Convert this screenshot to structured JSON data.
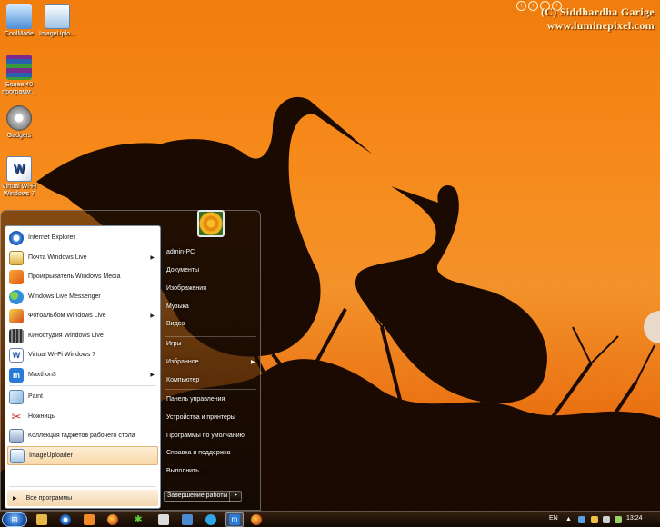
{
  "wallpaper": {
    "watermark_line1": "(C) Siddhardha Garige",
    "watermark_line2": "www.luminepixel.com",
    "controls": [
      "+",
      "+",
      "+",
      "+"
    ]
  },
  "desktop_icons": [
    {
      "label": "CoolMode",
      "icon": "app-icon"
    },
    {
      "label": "ImageUplo...",
      "icon": "image-uploader-icon"
    },
    {
      "label": "Более 40 программ...",
      "icon": "winrar-icon"
    },
    {
      "label": "Gadgets",
      "icon": "gadgets-icon"
    },
    {
      "label": "Virtual Wi-Fi Windows 7",
      "icon": "word-document-icon"
    }
  ],
  "start_menu": {
    "programs": [
      {
        "label": "Internet Explorer",
        "icon": "internet-explorer-icon",
        "submenu": false
      },
      {
        "label": "Почта Windows Live",
        "icon": "mail-icon",
        "submenu": true
      },
      {
        "label": "Проигрыватель Windows Media",
        "icon": "media-player-icon",
        "submenu": false
      },
      {
        "label": "Windows Live Messenger",
        "icon": "messenger-icon",
        "submenu": false
      },
      {
        "label": "Фотоальбом Windows Live",
        "icon": "photo-gallery-icon",
        "submenu": true
      },
      {
        "label": "Киностудия Windows Live",
        "icon": "movie-maker-icon",
        "submenu": false
      },
      {
        "label": "Virtual Wi-Fi Windows 7",
        "icon": "word-document-icon",
        "submenu": false
      },
      {
        "label": "Maxthon3",
        "icon": "maxthon-icon",
        "submenu": true
      },
      {
        "label": "Paint",
        "icon": "paint-icon",
        "submenu": false
      },
      {
        "label": "Ножницы",
        "icon": "scissors-icon",
        "submenu": false
      },
      {
        "label": "Коллекция гаджетов рабочего стола",
        "icon": "gadgets-icon",
        "submenu": false
      },
      {
        "label": "ImageUploader",
        "icon": "image-uploader-icon",
        "submenu": false,
        "selected": true
      }
    ],
    "all_programs": "Все программы",
    "right_links": [
      {
        "label": "admin-PC",
        "submenu": false
      },
      {
        "label": "Документы",
        "submenu": false
      },
      {
        "label": "Изображения",
        "submenu": false
      },
      {
        "label": "Музыка",
        "submenu": false
      },
      {
        "label": "Видео",
        "submenu": false
      },
      {
        "label": "Игры",
        "submenu": false
      },
      {
        "label": "Избранное",
        "submenu": true
      },
      {
        "label": "Компьютер",
        "submenu": false
      },
      {
        "label": "Панель управления",
        "submenu": false
      },
      {
        "label": "Устройства и принтеры",
        "submenu": false
      },
      {
        "label": "Программы по умолчанию",
        "submenu": false
      },
      {
        "label": "Справка и поддержка",
        "submenu": false
      },
      {
        "label": "Выполнить...",
        "submenu": false
      }
    ],
    "shutdown": "Завершение работы"
  },
  "taskbar": {
    "pinned": [
      "folder-icon",
      "internet-explorer-icon",
      "media-player-icon",
      "firefox-icon",
      "gadget-icon",
      "mail-icon",
      "wordpad-icon",
      "skype-icon",
      "maxthon-icon",
      "firefox-icon"
    ],
    "language": "EN",
    "time": "13:24"
  }
}
